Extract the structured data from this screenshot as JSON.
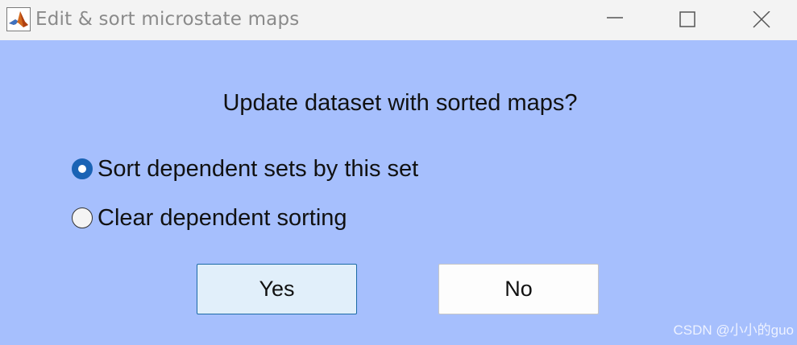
{
  "window": {
    "title": "Edit & sort microstate maps",
    "icon": "matlab-icon"
  },
  "dialog": {
    "question": "Update dataset with sorted maps?",
    "options": [
      {
        "label": "Sort dependent sets by this set",
        "checked": true
      },
      {
        "label": "Clear dependent sorting",
        "checked": false
      }
    ],
    "yes_label": "Yes",
    "no_label": "No"
  },
  "watermark": "CSDN @小小的guo",
  "colors": {
    "background": "#a6bffd",
    "titlebar": "#f3f3f3",
    "radio_selected": "#1a63b5",
    "yes_button": "#e1effa",
    "no_button": "#fdfdfd"
  }
}
